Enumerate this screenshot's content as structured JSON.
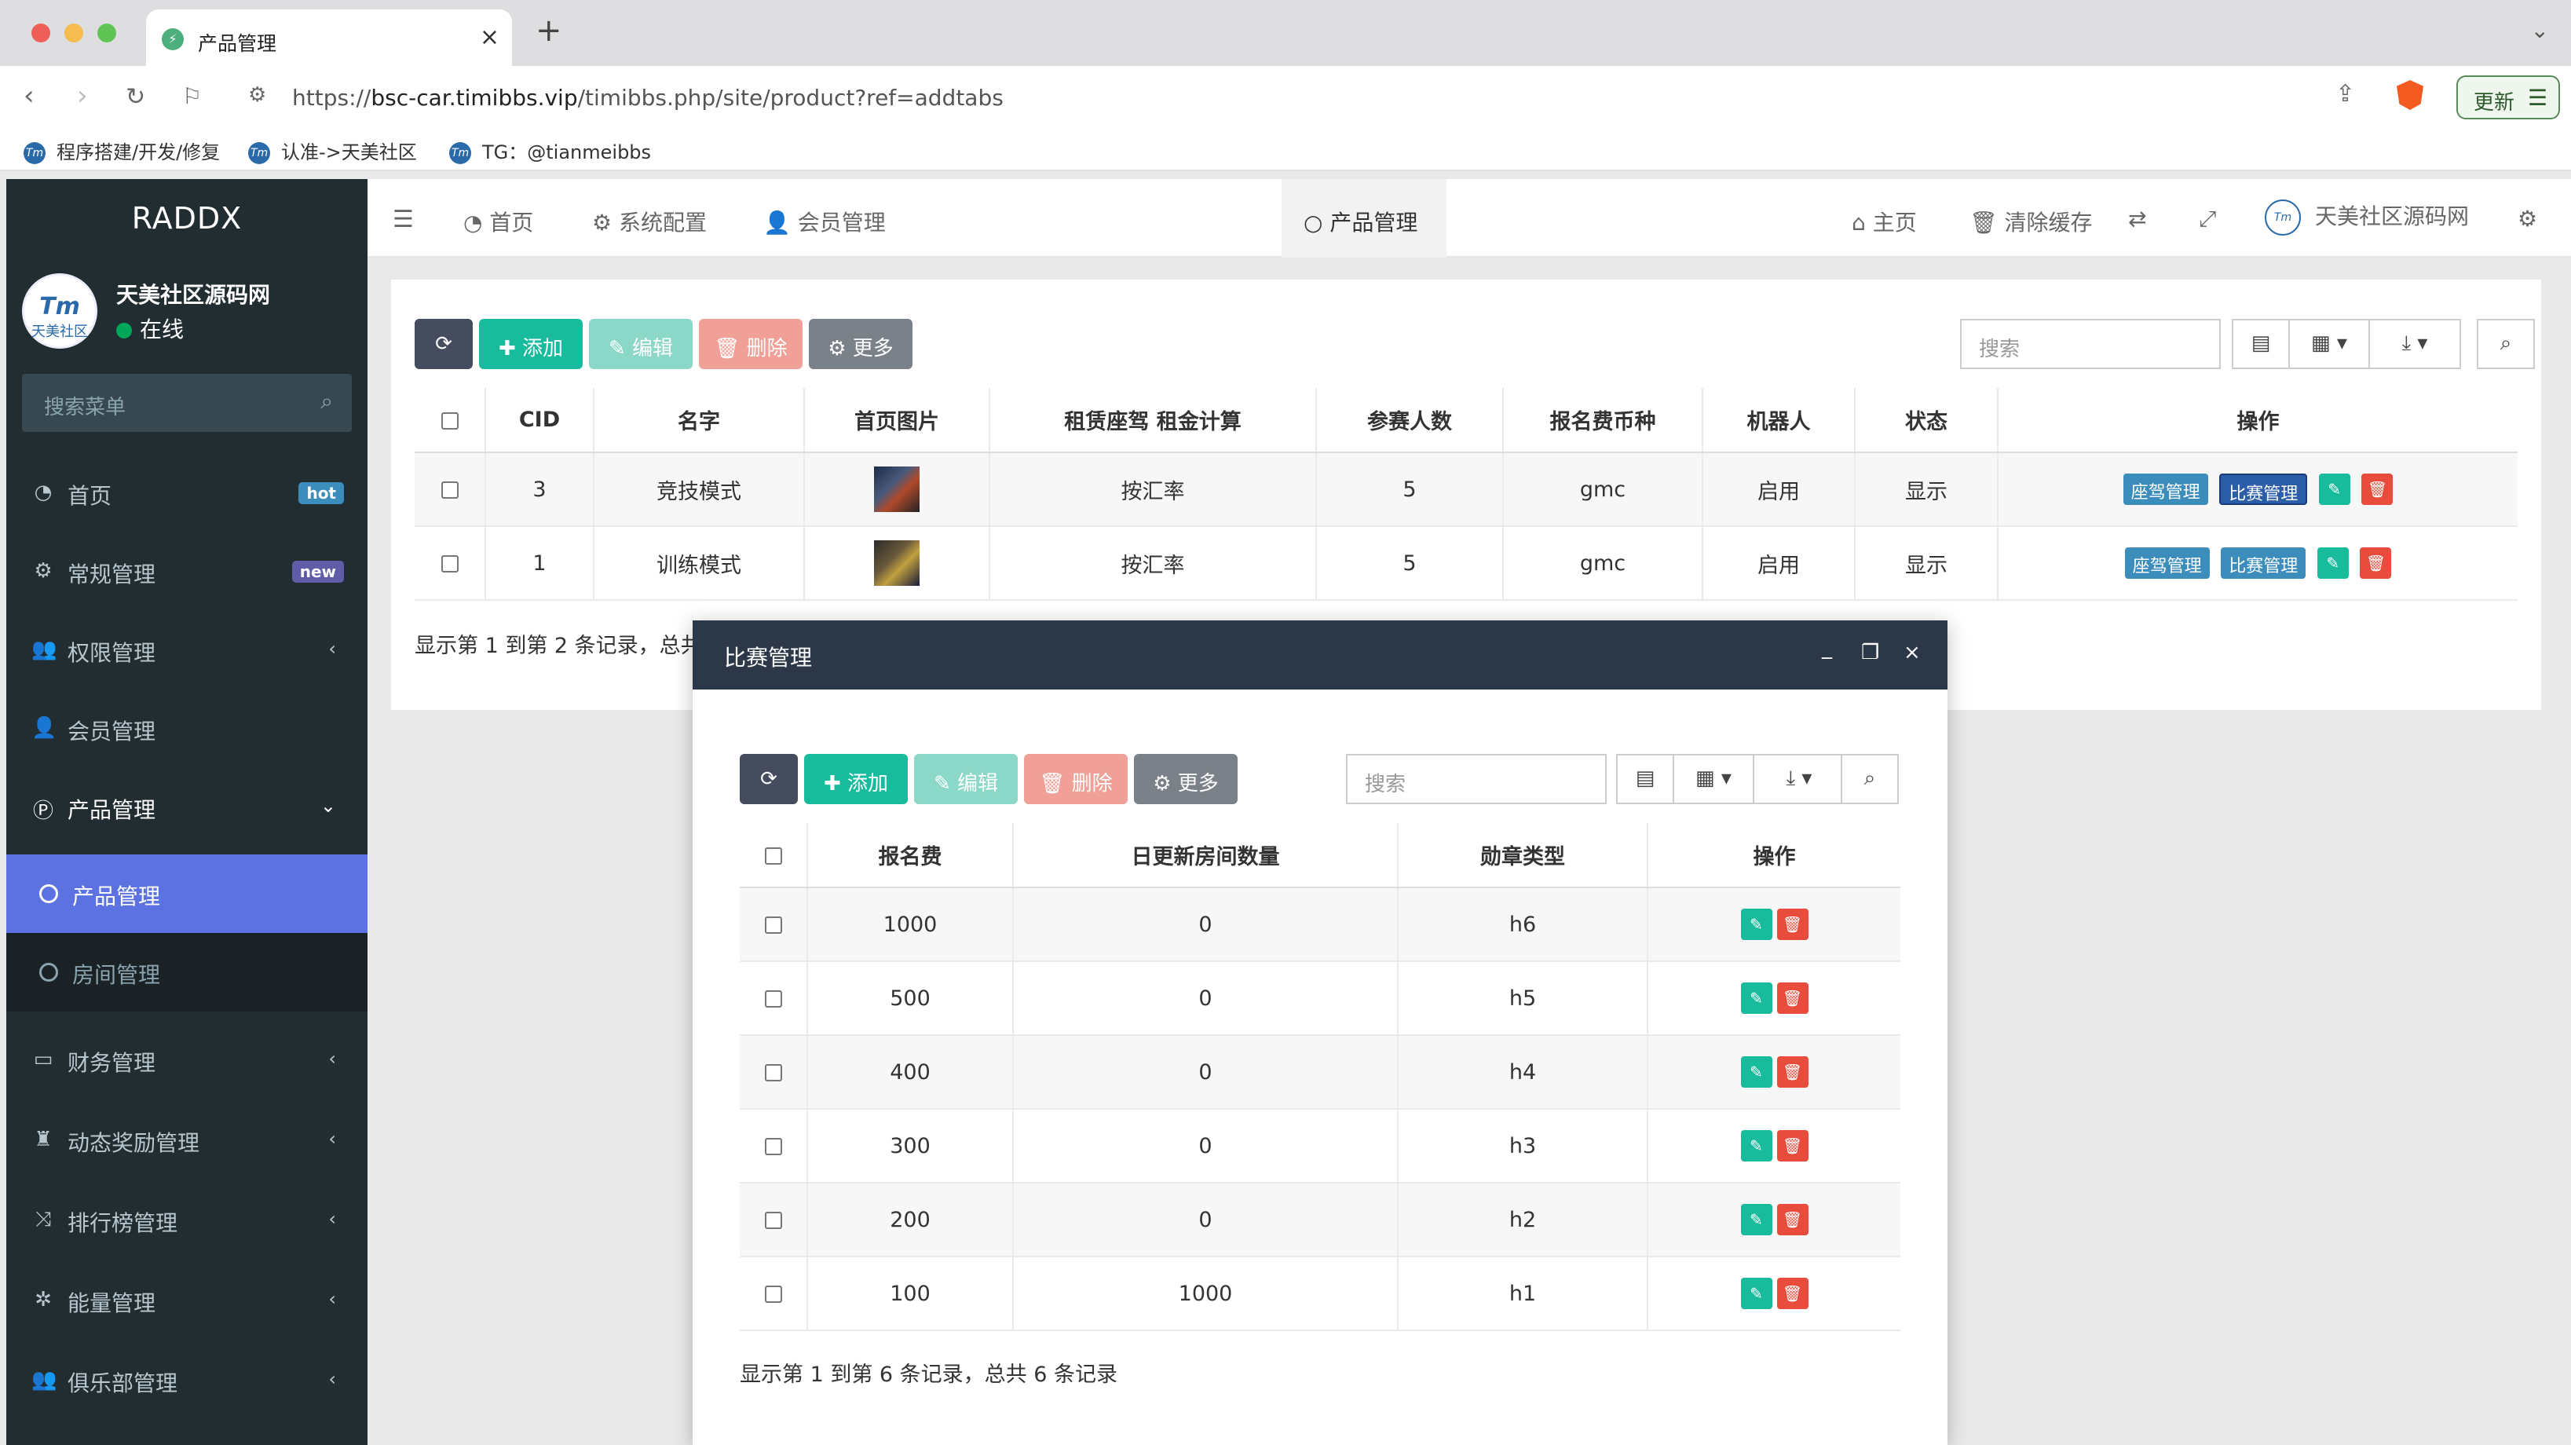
{
  "browser": {
    "tab_title": "产品管理",
    "url_prefix": "https://",
    "url_host": "bsc-car.timibbs.vip",
    "url_path": "/timibbs.php/site/product?ref=addtabs",
    "update_label": "更新",
    "bookmarks": [
      "程序搭建/开发/修复",
      "认准->天美社区",
      "TG：@tianmeibbs"
    ]
  },
  "sidebar": {
    "brand": "RADDX",
    "user_name": "天美社区源码网",
    "user_status": "在线",
    "avatar_text": "天美社区",
    "search_placeholder": "搜索菜单",
    "items": [
      {
        "label": "首页",
        "badge": "hot"
      },
      {
        "label": "常规管理",
        "badge": "new"
      },
      {
        "label": "权限管理"
      },
      {
        "label": "会员管理"
      },
      {
        "label": "产品管理"
      },
      {
        "label": "财务管理"
      },
      {
        "label": "动态奖励管理"
      },
      {
        "label": "排行榜管理"
      },
      {
        "label": "能量管理"
      },
      {
        "label": "俱乐部管理"
      }
    ],
    "subitems": [
      {
        "label": "产品管理"
      },
      {
        "label": "房间管理"
      }
    ]
  },
  "topnav": {
    "tabs": [
      "首页",
      "系统配置",
      "会员管理",
      "产品管理"
    ],
    "right": {
      "home": "主页",
      "clear_cache": "清除缓存",
      "site_name": "天美社区源码网"
    }
  },
  "toolbar": {
    "add": "添加",
    "edit": "编辑",
    "delete": "删除",
    "more": "更多",
    "search_placeholder": "搜索"
  },
  "product_table": {
    "headers": [
      "CID",
      "名字",
      "首页图片",
      "租赁座驾 租金计算",
      "参赛人数",
      "报名费币种",
      "机器人",
      "状态",
      "操作"
    ],
    "rows": [
      {
        "cid": "3",
        "name": "竞技模式",
        "rent_calc": "按汇率",
        "players": "5",
        "currency": "gmc",
        "robot": "启用",
        "status": "显示"
      },
      {
        "cid": "1",
        "name": "训练模式",
        "rent_calc": "按汇率",
        "players": "5",
        "currency": "gmc",
        "robot": "启用",
        "status": "显示"
      }
    ],
    "op_labels": {
      "car": "座驾管理",
      "match": "比赛管理"
    },
    "footer": "显示第 1 到第 2 条记录，总共"
  },
  "modal": {
    "title": "比赛管理",
    "headers": [
      "报名费",
      "日更新房间数量",
      "勋章类型",
      "操作"
    ],
    "rows": [
      {
        "fee": "1000",
        "daily_rooms": "0",
        "medal": "h6"
      },
      {
        "fee": "500",
        "daily_rooms": "0",
        "medal": "h5"
      },
      {
        "fee": "400",
        "daily_rooms": "0",
        "medal": "h4"
      },
      {
        "fee": "300",
        "daily_rooms": "0",
        "medal": "h3"
      },
      {
        "fee": "200",
        "daily_rooms": "0",
        "medal": "h2"
      },
      {
        "fee": "100",
        "daily_rooms": "1000",
        "medal": "h1"
      }
    ],
    "footer": "显示第 1 到第 6 条记录，总共 6 条记录"
  },
  "colors": {
    "sidebar_bg": "#222d32",
    "active_sub": "#5b72e0",
    "success": "#18bc9c",
    "danger": "#e74c3c",
    "primary": "#3c8dbc",
    "modal_header": "#2c3848"
  }
}
